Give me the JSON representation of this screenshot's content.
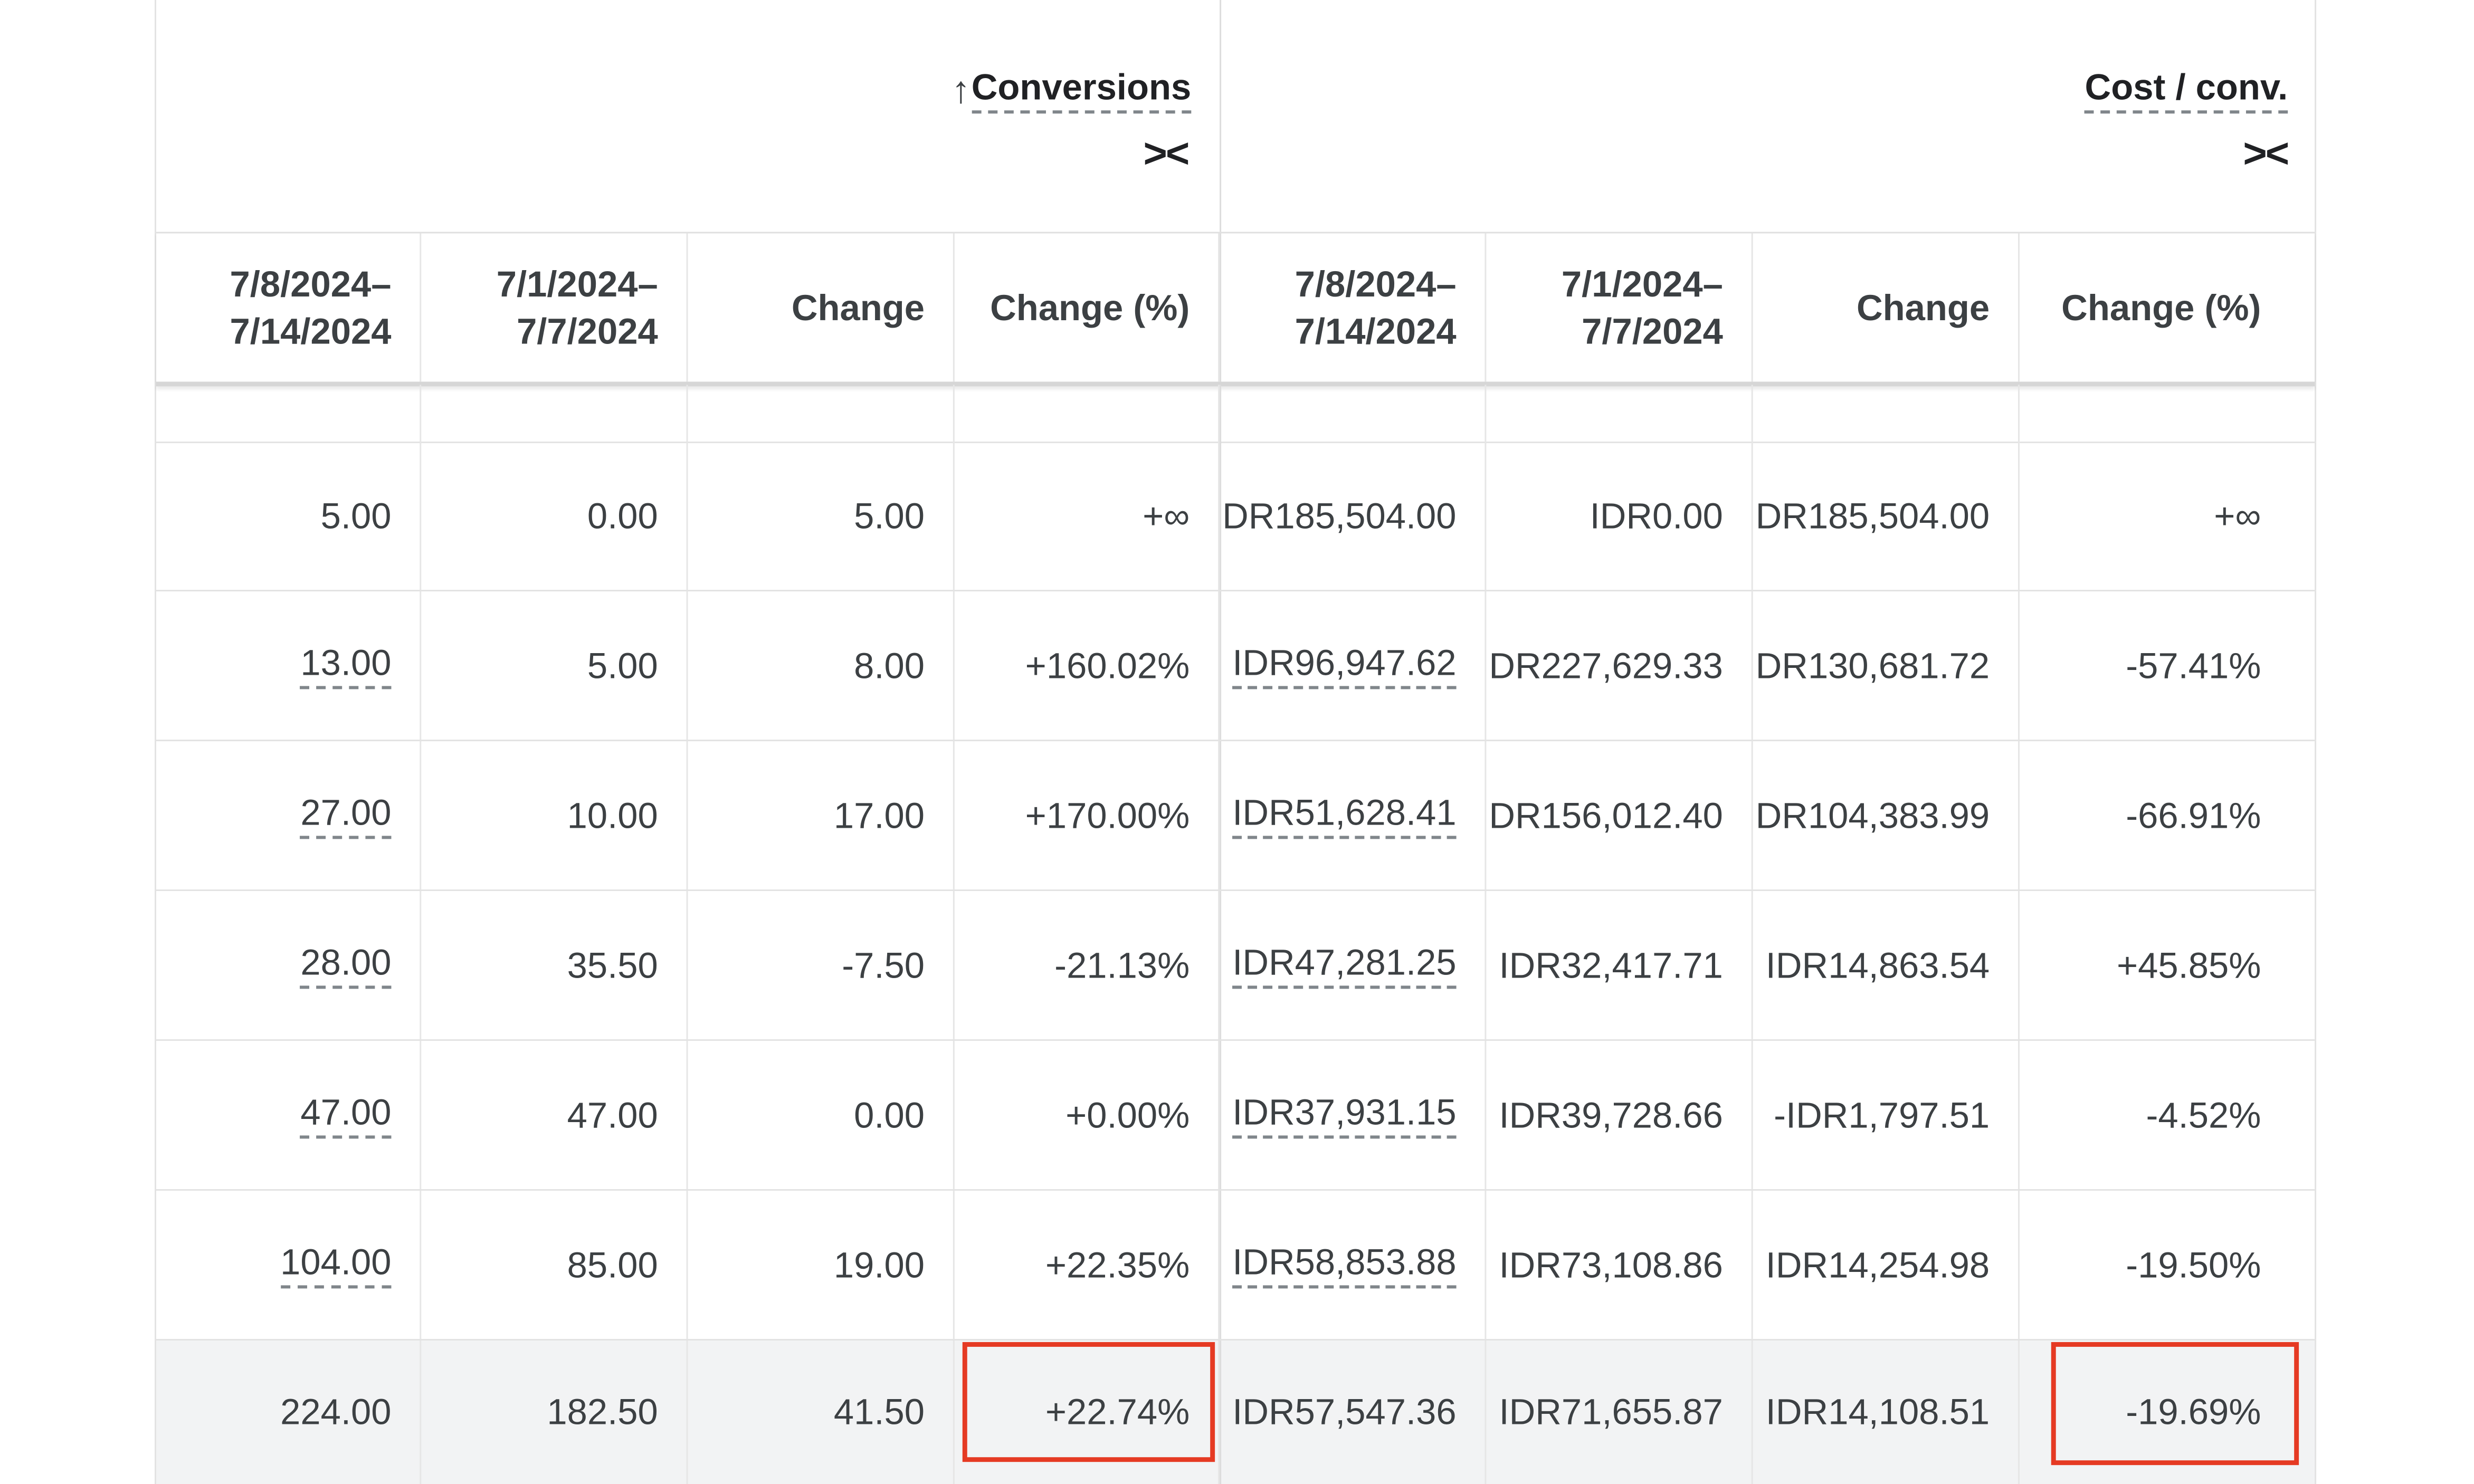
{
  "groups": {
    "conversions": {
      "title": "Conversions",
      "sort_icon": "↑",
      "collapse_icon": "><"
    },
    "cost_per_conv": {
      "title": "Cost / conv.",
      "collapse_icon": "><"
    }
  },
  "columns": [
    "7/8/2024–\n7/14/2024",
    "7/1/2024–\n7/7/2024",
    "Change",
    "Change (%)",
    "7/8/2024–\n7/14/2024",
    "7/1/2024–\n7/7/2024",
    "Change",
    "Change (%)"
  ],
  "rows": [
    [
      "5.00",
      "0.00",
      "5.00",
      "+∞",
      "DR185,504.00",
      "IDR0.00",
      "DR185,504.00",
      "+∞"
    ],
    [
      "13.00",
      "5.00",
      "8.00",
      "+160.02%",
      "IDR96,947.62",
      "DR227,629.33",
      "DR130,681.72",
      "-57.41%"
    ],
    [
      "27.00",
      "10.00",
      "17.00",
      "+170.00%",
      "IDR51,628.41",
      "DR156,012.40",
      "DR104,383.99",
      "-66.91%"
    ],
    [
      "28.00",
      "35.50",
      "-7.50",
      "-21.13%",
      "IDR47,281.25",
      "IDR32,417.71",
      "IDR14,863.54",
      "+45.85%"
    ],
    [
      "47.00",
      "47.00",
      "0.00",
      "+0.00%",
      "IDR37,931.15",
      "IDR39,728.66",
      "-IDR1,797.51",
      "-4.52%"
    ],
    [
      "104.00",
      "85.00",
      "19.00",
      "+22.35%",
      "IDR58,853.88",
      "IDR73,108.86",
      "IDR14,254.98",
      "-19.50%"
    ]
  ],
  "total": [
    "224.00",
    "182.50",
    "41.50",
    "+22.74%",
    "IDR57,547.36",
    "IDR71,655.87",
    "IDR14,108.51",
    "-19.69%"
  ],
  "highlight_color": "#e53a23"
}
